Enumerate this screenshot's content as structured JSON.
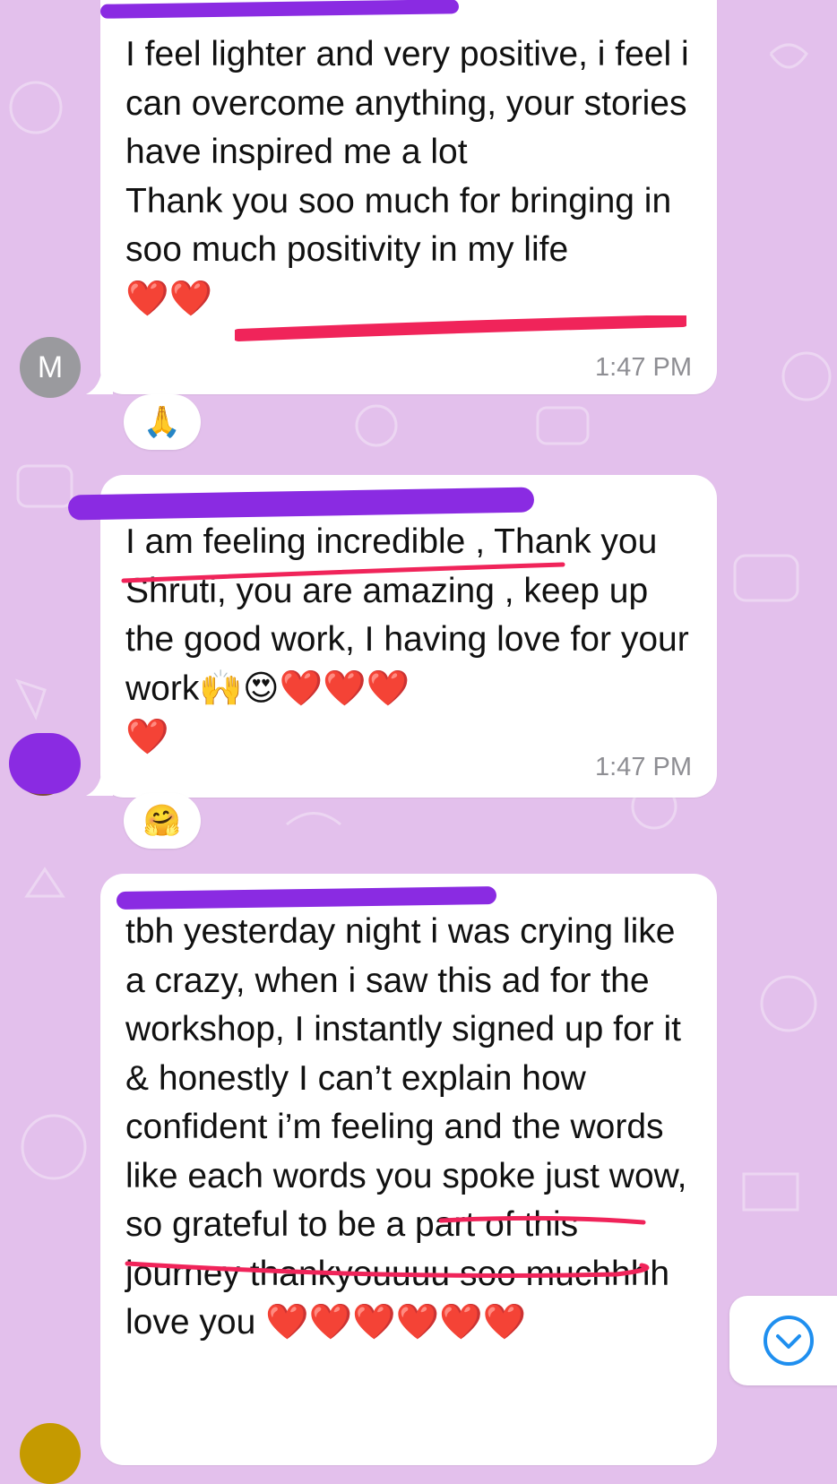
{
  "messages": [
    {
      "sender_initial": "M",
      "text": "I feel lighter and very positive, i feel i can overcome anything, your stories have inspired me a lot\nThank you soo much for bringing in soo much positivity in my life\n❤️❤️",
      "time": "1:47 PM",
      "reaction": "🙏"
    },
    {
      "text": "I am feeling incredible , Thank you Shruti,  you are amazing , keep up the good work, I having love for your work🙌😍❤️❤️❤️\n❤️",
      "time": "1:47 PM",
      "reaction": "🤗"
    },
    {
      "text": "tbh yesterday night i was crying like a crazy, when i saw this ad for the workshop, I instantly signed up for it & honestly I can’t explain how confident i’m feeling and the words like each words you spoke just wow, so grateful to be a part of this journey thankyouuuu soo muchhhh love you ❤️❤️❤️❤️❤️❤️"
    }
  ],
  "colors": {
    "background": "#e3c0ec",
    "bubble": "#ffffff",
    "redaction": "#8a2be2",
    "underline": "#f0245a",
    "scroll_icon": "#1f8fef"
  },
  "icons": {
    "scroll_down": "chevron-down-circle-icon"
  }
}
